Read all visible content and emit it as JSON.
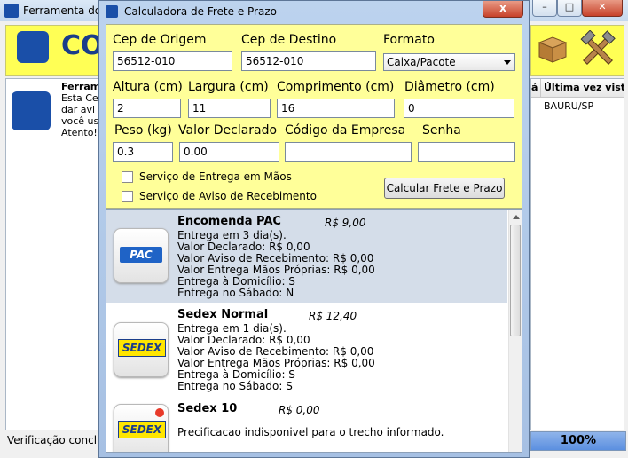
{
  "background_window": {
    "title": "Ferramenta dos",
    "banner_text": "CO",
    "left_panel_lines": [
      "Ferram",
      "Esta Ce",
      "dar avi",
      "você us",
      "Atento!"
    ],
    "right_panel_header_col1": "á",
    "right_panel_header_col2": "Última vez visto",
    "right_panel_cell": "BAURU/SP",
    "status_text": "Verificação concluíd",
    "progress_label": "100%",
    "progress": 1.0,
    "min_label": "–",
    "max_label": "□",
    "close_label": "✕"
  },
  "dialog": {
    "title": "Calculadora de Frete e Prazo",
    "close_label": "x",
    "fields": {
      "cep_origem": {
        "label": "Cep de Origem",
        "value": "56512-010"
      },
      "cep_destino": {
        "label": "Cep de Destino",
        "value": "56512-010"
      },
      "formato": {
        "label": "Formato",
        "value": "Caixa/Pacote"
      },
      "altura": {
        "label": "Altura (cm)",
        "value": "2"
      },
      "largura": {
        "label": "Largura (cm)",
        "value": "11"
      },
      "comprimento": {
        "label": "Comprimento (cm)",
        "value": "16"
      },
      "diametro": {
        "label": "Diâmetro (cm)",
        "value": "0"
      },
      "peso": {
        "label": "Peso (kg)",
        "value": "0.3"
      },
      "valor_declarado": {
        "label": "Valor Declarado",
        "value": "0.00"
      },
      "codigo_empresa": {
        "label": "Código da Empresa",
        "value": ""
      },
      "senha": {
        "label": "Senha",
        "value": ""
      }
    },
    "checkboxes": {
      "maos": {
        "label": "Serviço de Entrega em Mãos",
        "checked": false
      },
      "aviso": {
        "label": "Serviço de Aviso de Recebimento",
        "checked": false
      }
    },
    "calc_button": "Calcular Frete e Prazo",
    "services": [
      {
        "name": "Encomenda PAC",
        "price": "R$ 9,00",
        "logo_text": "PAC",
        "lines": [
          "Entrega em 3 dia(s).",
          "Valor Declarado: R$ 0,00",
          "Valor Aviso de Recebimento: R$ 0,00",
          "Valor Entrega Mãos Próprias: R$ 0,00",
          "Entrega à Domicílio: S",
          "Entrega no Sábado: N"
        ]
      },
      {
        "name": "Sedex Normal",
        "price": "R$ 12,40",
        "logo_text": "SEDEX",
        "lines": [
          "Entrega em 1 dia(s).",
          "Valor Declarado: R$ 0,00",
          "Valor Aviso de Recebimento: R$ 0,00",
          "Valor Entrega Mãos Próprias: R$ 0,00",
          "Entrega à Domicílio: S",
          "Entrega no Sábado: S"
        ]
      },
      {
        "name": "Sedex 10",
        "price": "R$ 0,00",
        "logo_text": "SEDEX",
        "lines": [
          "Precificacao indisponivel para o trecho informado."
        ]
      }
    ]
  },
  "colors": {
    "form_bg": "#ffff99",
    "selected_row": "#d4dde9",
    "close_red": "#c7422a",
    "brand_blue": "#1a4fa8"
  }
}
